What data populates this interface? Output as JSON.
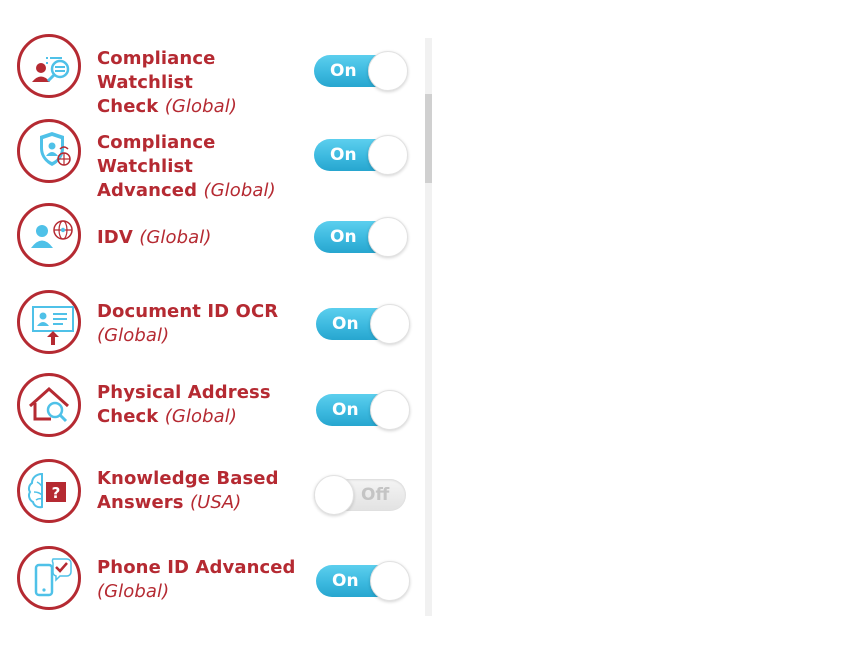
{
  "services": [
    {
      "name": "Compliance Watchlist",
      "name_line2": "Check",
      "scope": "(Global)",
      "state": "On",
      "icon": "watchlist-check-icon"
    },
    {
      "name": "Compliance Watchlist",
      "name_line2": "Advanced",
      "scope": "(Global)",
      "state": "On",
      "icon": "watchlist-shield-icon"
    },
    {
      "name": "IDV",
      "name_line2": "",
      "scope": "(Global)",
      "state": "On",
      "icon": "idv-globe-icon"
    },
    {
      "name": "Document ID OCR",
      "name_line2": "",
      "scope": "(Global)",
      "state": "On",
      "icon": "document-id-upload-icon"
    },
    {
      "name": "Physical Address",
      "name_line2": "Check",
      "scope": "(Global)",
      "state": "On",
      "icon": "house-search-icon"
    },
    {
      "name": "Knowledge Based",
      "name_line2": "Answers",
      "scope": "(USA)",
      "state": "Off",
      "icon": "brain-question-icon"
    },
    {
      "name": "Phone ID Advanced",
      "name_line2": "",
      "scope": "(Global)",
      "state": "On",
      "icon": "phone-check-icon"
    }
  ],
  "colors": {
    "brand_red": "#b52a32",
    "toggle_on": "#3cb9df",
    "toggle_off": "#e8e8e8",
    "icon_blue": "#4fc1e8"
  }
}
